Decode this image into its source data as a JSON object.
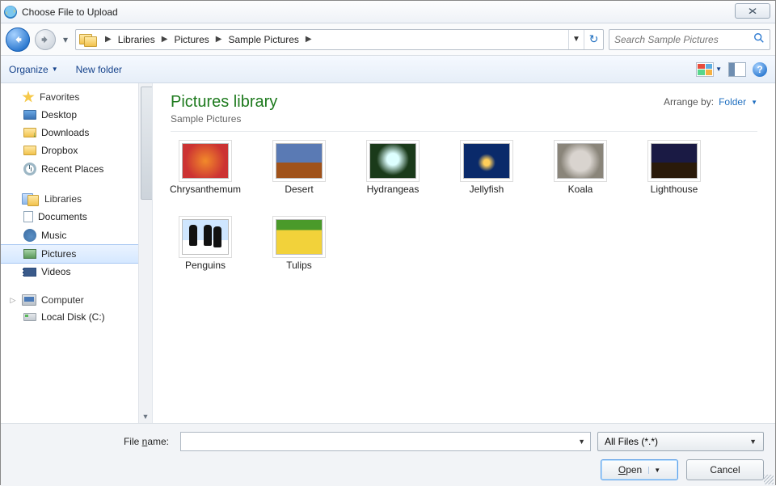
{
  "window": {
    "title": "Choose File to Upload"
  },
  "breadcrumb": {
    "segments": [
      "Libraries",
      "Pictures",
      "Sample Pictures"
    ]
  },
  "search": {
    "placeholder": "Search Sample Pictures"
  },
  "toolbar": {
    "organize": "Organize",
    "newfolder": "New folder"
  },
  "nav": {
    "favorites": {
      "label": "Favorites",
      "items": [
        "Desktop",
        "Downloads",
        "Dropbox",
        "Recent Places"
      ]
    },
    "libraries": {
      "label": "Libraries",
      "items": [
        "Documents",
        "Music",
        "Pictures",
        "Videos"
      ],
      "selected": 2
    },
    "computer": {
      "label": "Computer",
      "items": [
        "Local Disk (C:)"
      ]
    }
  },
  "content": {
    "title": "Pictures library",
    "subtitle": "Sample Pictures",
    "arrange_label": "Arrange by:",
    "arrange_value": "Folder",
    "items": [
      "Chrysanthemum",
      "Desert",
      "Hydrangeas",
      "Jellyfish",
      "Koala",
      "Lighthouse",
      "Penguins",
      "Tulips"
    ]
  },
  "bottom": {
    "filename_label_pre": "File ",
    "filename_label_u": "n",
    "filename_label_post": "ame:",
    "filename_value": "",
    "filter": "All Files (*.*)",
    "open_pre": "",
    "open_u": "O",
    "open_post": "pen",
    "cancel": "Cancel"
  }
}
